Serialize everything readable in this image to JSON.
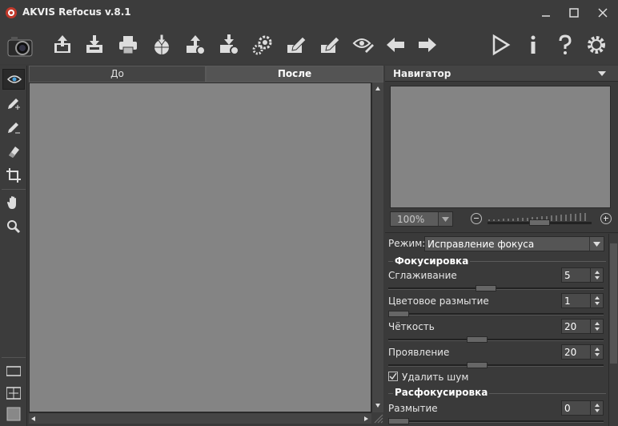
{
  "app": {
    "title": "AKVIS Refocus v.8.1"
  },
  "toolbar": {
    "items": [
      "camera-icon",
      "open-icon",
      "save-icon",
      "print-icon",
      "publish-icon",
      "batch-icon",
      "batch-settings-icon",
      "gear-icon",
      "edit-icon",
      "edit2-icon",
      "eye-pen-icon",
      "back-icon",
      "forward-icon",
      "run-icon",
      "info-icon",
      "help-icon",
      "settings-icon"
    ]
  },
  "tabs": {
    "before": "До",
    "after": "После"
  },
  "navigator": {
    "title": "Навигатор",
    "zoom": "100%"
  },
  "settings": {
    "mode_label": "Режим:",
    "mode_value": "Исправление фокуса",
    "focus_group": "Фокусировка",
    "params": [
      {
        "label": "Сглаживание",
        "value": "5"
      },
      {
        "label": "Цветовое размытие",
        "value": "1"
      },
      {
        "label": "Чёткость",
        "value": "20"
      },
      {
        "label": "Проявление",
        "value": "20"
      }
    ],
    "remove_noise": "Удалить шум",
    "defocus_group": "Расфокусировка",
    "blur_label": "Размытие",
    "blur_value": "0"
  },
  "colors": {
    "bg": "#3a3a3a",
    "canvas": "#848484"
  }
}
